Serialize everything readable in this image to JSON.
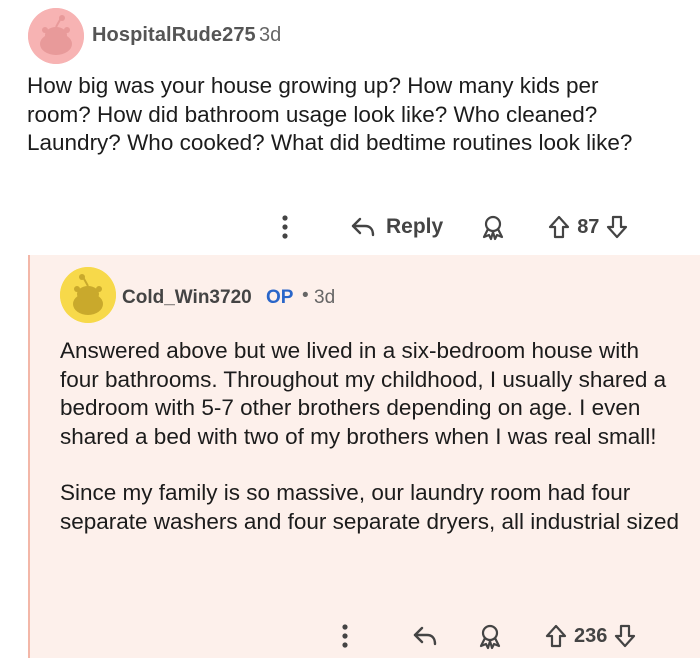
{
  "comment1": {
    "username": "HospitalRude275",
    "time": "3d",
    "body": "How big was your house growing up? How many kids per room? How did bathroom usage look like? Who cleaned? Laundry? Who cooked? What did bedtime routines look like?",
    "actions": {
      "reply_label": "Reply",
      "vote_count": "87"
    }
  },
  "comment2": {
    "username": "Cold_Win3720",
    "op_badge": "OP",
    "separator": "•",
    "time": "3d",
    "paragraphs": [
      "Answered above but we lived in a six-bedroom house with four bathrooms. Throughout my childhood, I usually shared a bedroom with 5-7 other brothers depending on age. I even shared a bed with two of my brothers when I was real small!",
      "Since my family is so massive, our laundry room had four separate washers and four separate dryers, all industrial sized"
    ],
    "actions": {
      "vote_count": "236"
    }
  },
  "icons": {
    "more": "more-options-icon",
    "reply": "reply-arrow-icon",
    "award": "award-icon",
    "upvote": "upvote-arrow-icon",
    "downvote": "downvote-arrow-icon"
  },
  "colors": {
    "op_badge": "#2a66c9",
    "reply_background": "#fdf0eb",
    "thread_line": "#f3b7a8",
    "avatar1_bg": "#f7b3b3",
    "avatar2_bg": "#f7d94a"
  }
}
